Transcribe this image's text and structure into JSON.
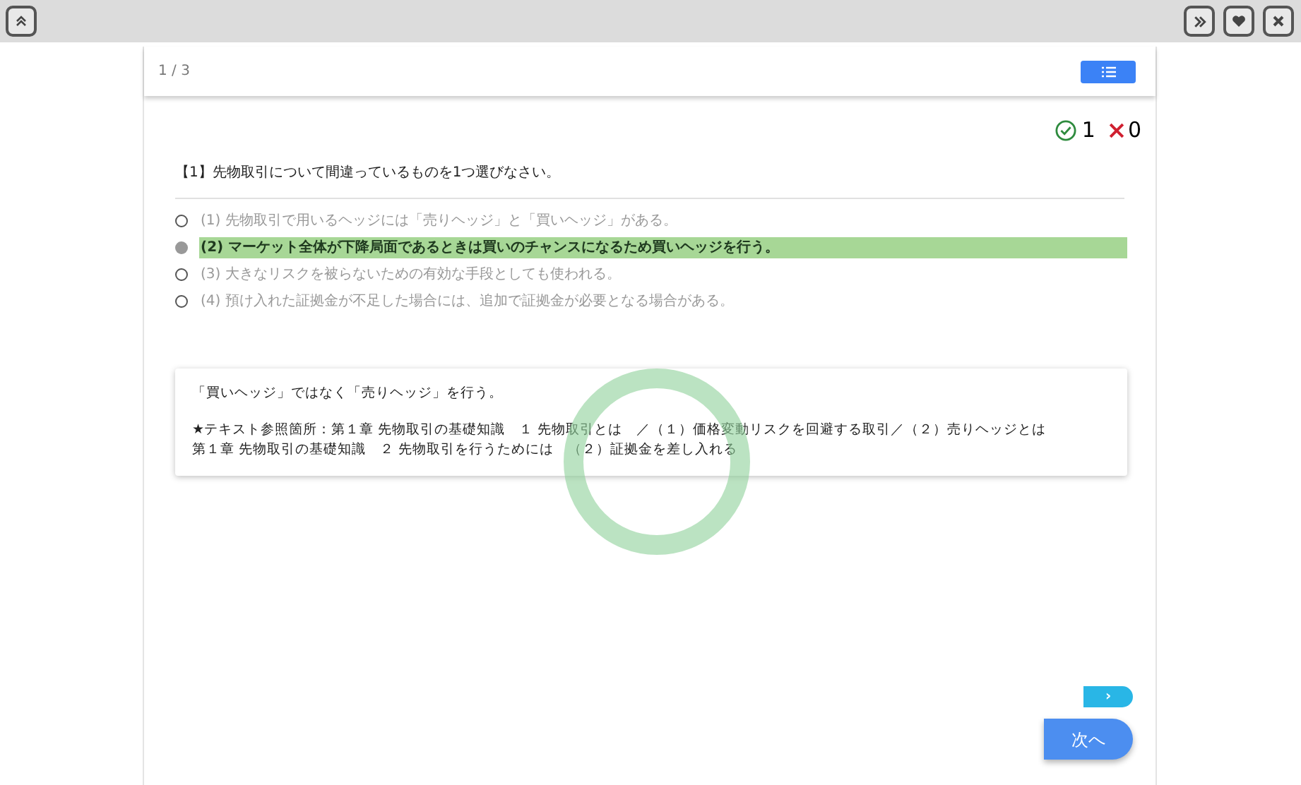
{
  "progress": "1 / 3",
  "score": {
    "correct": "1",
    "wrong": "0"
  },
  "question": "【1】先物取引について間違っているものを1つ選びなさい。",
  "options": [
    {
      "label": "(1) 先物取引で用いるヘッジには「売りヘッジ」と「買いヘッジ」がある。",
      "selected": false
    },
    {
      "label": "(2) マーケット全体が下降局面であるときは買いのチャンスになるため買いヘッジを行う。",
      "selected": true
    },
    {
      "label": "(3) 大きなリスクを被らないための有効な手段としても使われる。",
      "selected": false
    },
    {
      "label": "(4) 預け入れた証拠金が不足した場合には、追加で証拠金が必要となる場合がある。",
      "selected": false
    }
  ],
  "explanation": {
    "text": "「買いヘッジ」ではなく「売りヘッジ」を行う。",
    "references": [
      "★テキスト参照箇所：第１章 先物取引の基礎知識　１ 先物取引とは　／（１）価格変動リスクを回避する取引／（２）売りヘッジとは",
      "第１章 先物取引の基礎知識　２ 先物取引を行うためには　（２）証拠金を差し入れる"
    ]
  },
  "buttons": {
    "small": "›",
    "next": "次へ"
  }
}
